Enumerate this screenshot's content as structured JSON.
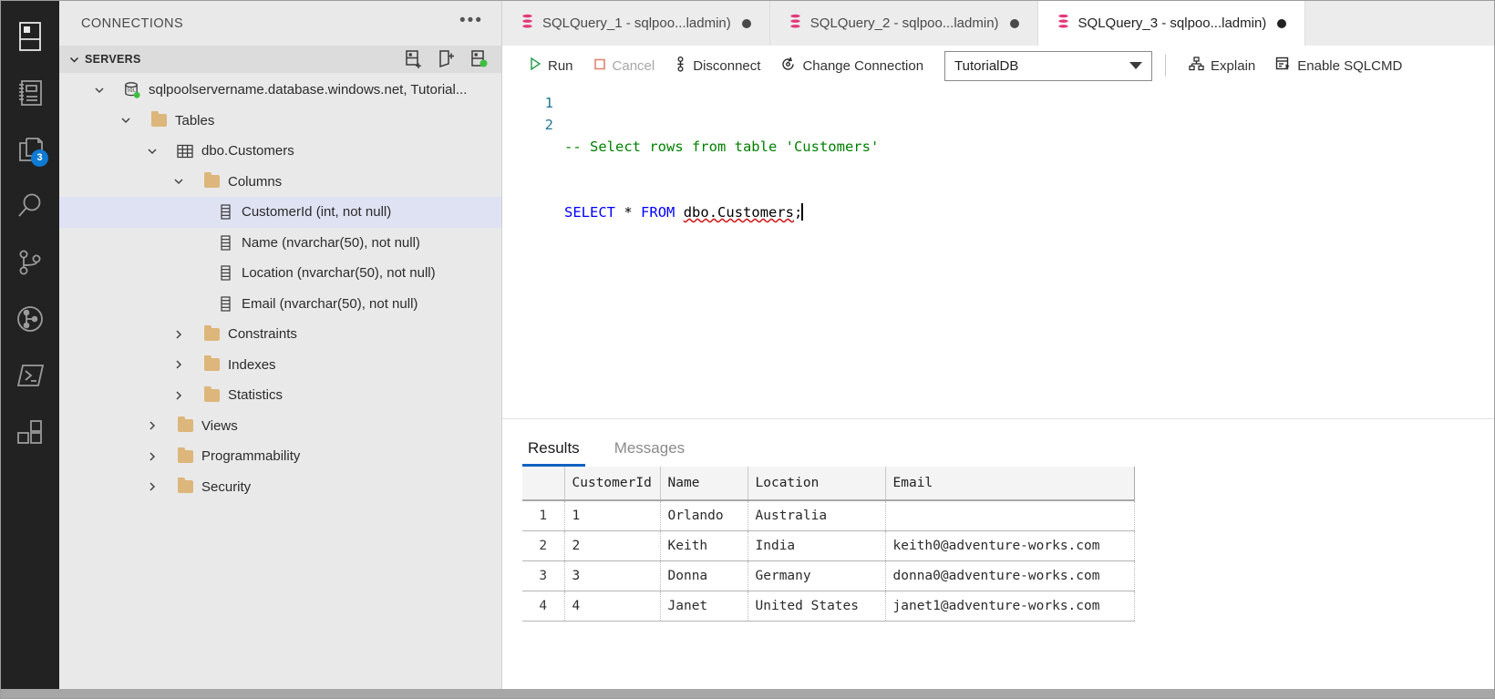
{
  "activitybar": {
    "items": [
      {
        "name": "servers-icon",
        "title": "Servers"
      },
      {
        "name": "notebook-icon",
        "title": "Notebooks"
      },
      {
        "name": "files-icon",
        "title": "Explorer",
        "badge": "3"
      },
      {
        "name": "search-icon",
        "title": "Search"
      },
      {
        "name": "source-control-icon",
        "title": "Source Control"
      },
      {
        "name": "git-graph-icon",
        "title": "Git Graph"
      },
      {
        "name": "terminal-icon",
        "title": "Terminal"
      },
      {
        "name": "extensions-icon",
        "title": "Extensions"
      }
    ]
  },
  "sidebar": {
    "title": "CONNECTIONS",
    "more_label": "•••",
    "section": {
      "label": "SERVERS",
      "actions": [
        {
          "name": "add-connection-icon",
          "title": "New Connection"
        },
        {
          "name": "add-connection-group-icon",
          "title": "New Server Group"
        },
        {
          "name": "refresh-servers-icon",
          "title": "Refresh"
        }
      ]
    },
    "tree": [
      {
        "label": "sqlpoolservername.database.windows.net, Tutorial...",
        "icon": "database-icon",
        "indent": 0,
        "chevron": "down",
        "selected": false
      },
      {
        "label": "Tables",
        "icon": "folder-icon",
        "indent": 1,
        "chevron": "down",
        "selected": false
      },
      {
        "label": "dbo.Customers",
        "icon": "table-icon",
        "indent": 2,
        "chevron": "down",
        "selected": false
      },
      {
        "label": "Columns",
        "icon": "folder-icon",
        "indent": 3,
        "chevron": "down",
        "selected": false
      },
      {
        "label": "CustomerId (int, not null)",
        "icon": "column-icon",
        "indent": 4,
        "chevron": "none",
        "selected": true
      },
      {
        "label": "Name (nvarchar(50), not null)",
        "icon": "column-icon",
        "indent": 4,
        "chevron": "none",
        "selected": false
      },
      {
        "label": "Location (nvarchar(50), not null)",
        "icon": "column-icon",
        "indent": 4,
        "chevron": "none",
        "selected": false
      },
      {
        "label": "Email (nvarchar(50), not null)",
        "icon": "column-icon",
        "indent": 4,
        "chevron": "none",
        "selected": false
      },
      {
        "label": "Constraints",
        "icon": "folder-icon",
        "indent": 3,
        "chevron": "right",
        "selected": false
      },
      {
        "label": "Indexes",
        "icon": "folder-icon",
        "indent": 3,
        "chevron": "right",
        "selected": false
      },
      {
        "label": "Statistics",
        "icon": "folder-icon",
        "indent": 3,
        "chevron": "right",
        "selected": false
      },
      {
        "label": "Views",
        "icon": "folder-icon",
        "indent": 2,
        "chevron": "right",
        "selected": false
      },
      {
        "label": "Programmability",
        "icon": "folder-icon",
        "indent": 2,
        "chevron": "right",
        "selected": false
      },
      {
        "label": "Security",
        "icon": "folder-icon",
        "indent": 2,
        "chevron": "right",
        "selected": false
      }
    ]
  },
  "tabs": [
    {
      "label": "SQLQuery_1 - sqlpoo...ladmin)",
      "active": false,
      "dirty": true
    },
    {
      "label": "SQLQuery_2 - sqlpoo...ladmin)",
      "active": false,
      "dirty": true
    },
    {
      "label": "SQLQuery_3 - sqlpoo...ladmin)",
      "active": true,
      "dirty": true
    }
  ],
  "toolbar": {
    "run_label": "Run",
    "cancel_label": "Cancel",
    "disconnect_label": "Disconnect",
    "change_connection_label": "Change Connection",
    "database_value": "TutorialDB",
    "explain_label": "Explain",
    "sqlcmd_label": "Enable SQLCMD"
  },
  "editor": {
    "line_numbers": [
      "1",
      "2"
    ],
    "line1_comment": "-- Select rows from table 'Customers'",
    "line2": {
      "select": "SELECT",
      "star": "*",
      "from": "FROM",
      "identifier": "dbo.Customers",
      "terminator": ";"
    }
  },
  "results": {
    "tabs": [
      {
        "label": "Results",
        "active": true
      },
      {
        "label": "Messages",
        "active": false
      }
    ],
    "grid": {
      "row_header": "",
      "columns": [
        "CustomerId",
        "Name",
        "Location",
        "Email"
      ],
      "rows": [
        {
          "n": "1",
          "cells": [
            "1",
            "Orlando",
            "Australia",
            ""
          ]
        },
        {
          "n": "2",
          "cells": [
            "2",
            "Keith",
            "India",
            "keith0@adventure-works.com"
          ]
        },
        {
          "n": "3",
          "cells": [
            "3",
            "Donna",
            "Germany",
            "donna0@adventure-works.com"
          ]
        },
        {
          "n": "4",
          "cells": [
            "4",
            "Janet",
            "United States",
            "janet1@adventure-works.com"
          ]
        }
      ]
    }
  },
  "colors": {
    "accent": "#0f62c2",
    "run_green": "#2e9e4f",
    "cancel_red": "#e08a7d",
    "badge_blue": "#0e7ad4",
    "folder_tan": "#dcb67a",
    "tab_db_pink": "#e3377b",
    "connected_green": "#3fbf3f",
    "comment_green": "#008000",
    "keyword_blue": "#0000ff",
    "linenum_blue": "#237893",
    "selection": "#dfe2f2"
  }
}
